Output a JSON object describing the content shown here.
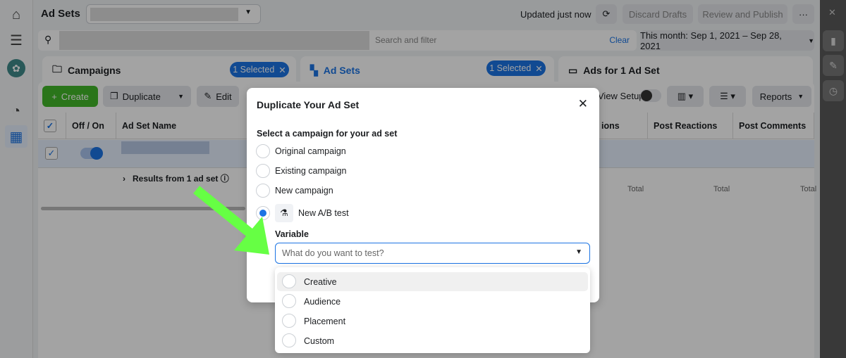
{
  "header": {
    "title": "Ad Sets",
    "updated": "Updated just now",
    "discard": "Discard Drafts",
    "review": "Review and Publish",
    "more": "···"
  },
  "search": {
    "placeholder": "Search and filter",
    "clear": "Clear",
    "date_range": "This month: Sep 1, 2021 – Sep 28, 2021"
  },
  "tabs": [
    {
      "label": "Campaigns",
      "badge": "1 Selected"
    },
    {
      "label": "Ad Sets",
      "badge": "1 Selected"
    },
    {
      "label": "Ads for 1 Ad Set"
    }
  ],
  "toolbar": {
    "create": "Create",
    "duplicate": "Duplicate",
    "edit": "Edit",
    "view_setup": "View Setup",
    "reports": "Reports"
  },
  "table": {
    "headers": [
      "Off / On",
      "Ad Set Name",
      "Post Reactions",
      "Post Comments"
    ],
    "partial_header": "ions",
    "results": "Results from 1 ad set",
    "total": "Total"
  },
  "modal": {
    "title": "Duplicate Your Ad Set",
    "section": "Select a campaign for your ad set",
    "options": [
      "Original campaign",
      "Existing campaign",
      "New campaign",
      "New A/B test"
    ],
    "selected": "New A/B test",
    "variable_label": "Variable",
    "variable_placeholder": "What do you want to test?"
  },
  "variable_options": [
    "Creative",
    "Audience",
    "Placement",
    "Custom"
  ],
  "colors": {
    "accent": "#1b74e4",
    "create": "#42b72a",
    "arrow": "#66ff44"
  }
}
